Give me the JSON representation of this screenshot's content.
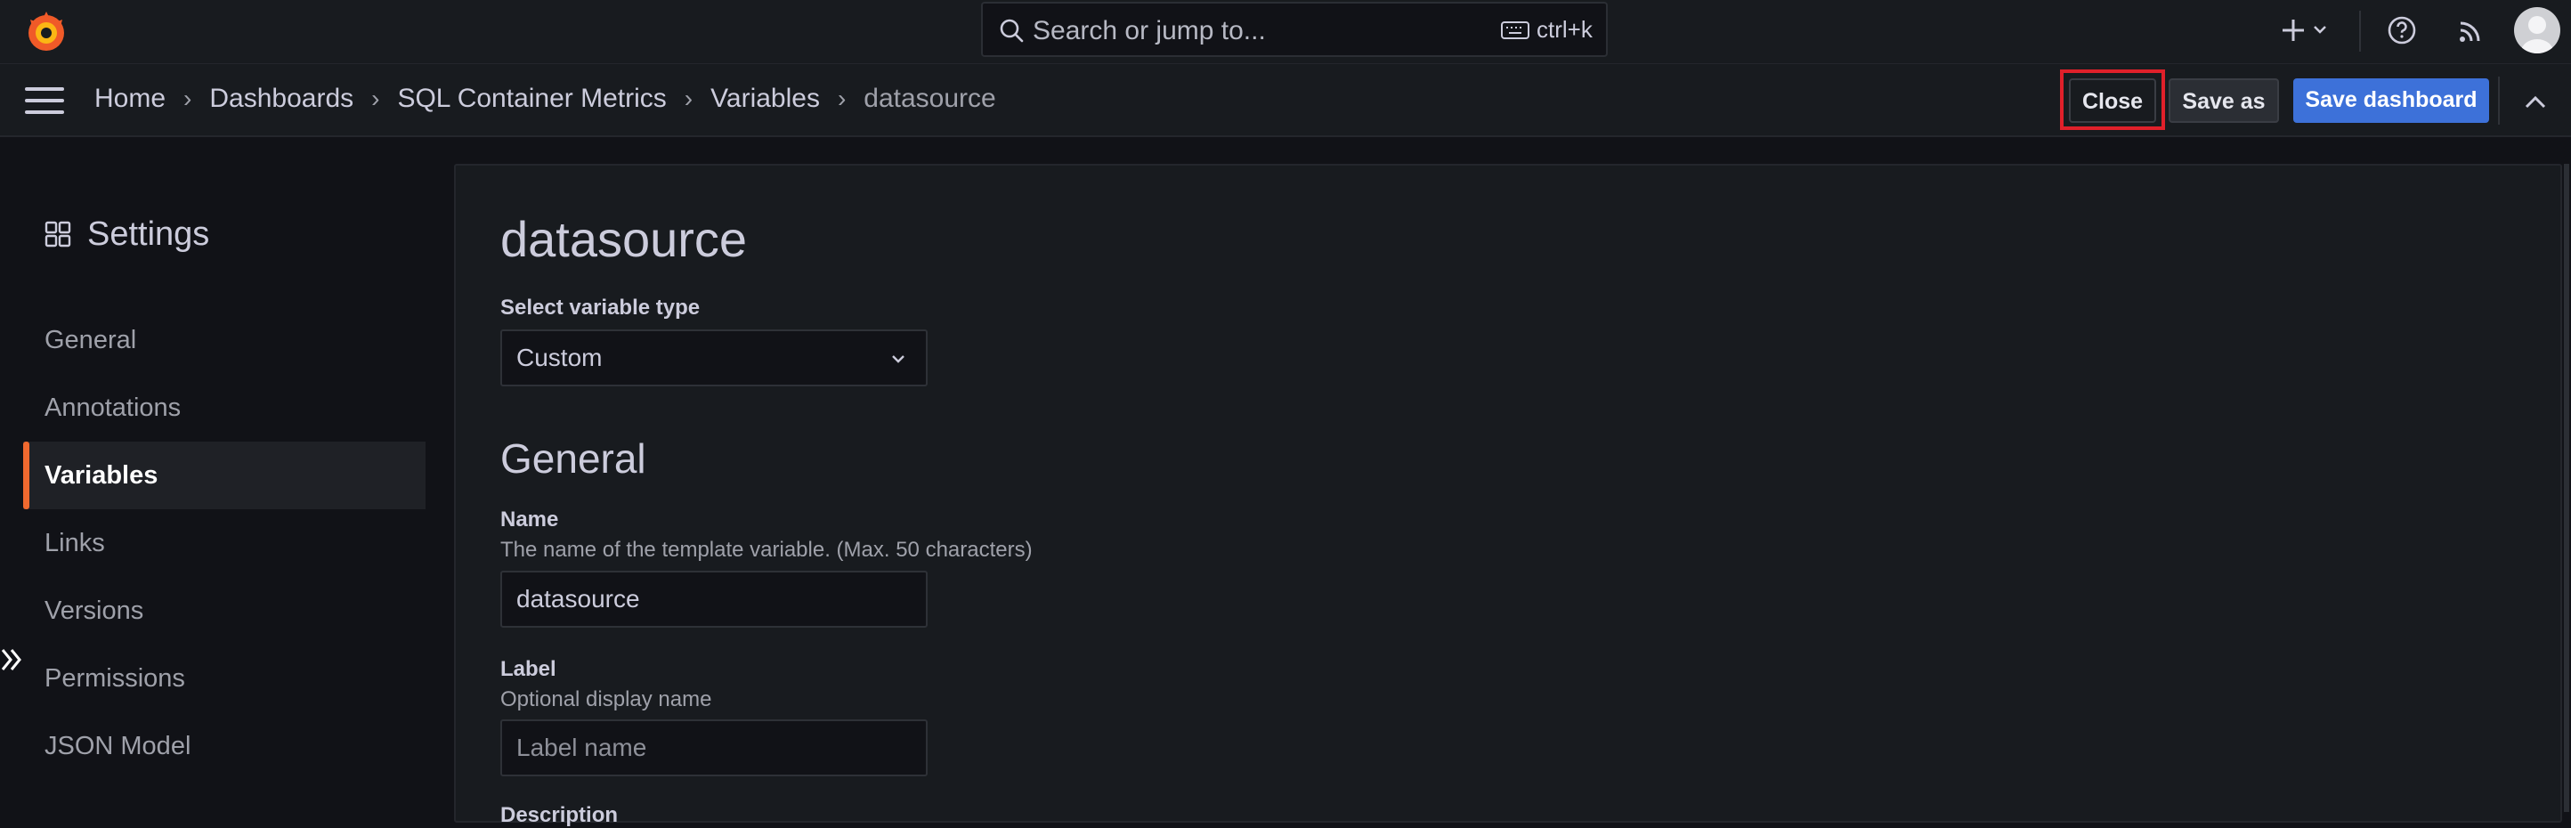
{
  "topbar": {
    "search_placeholder": "Search or jump to...",
    "shortcut": "ctrl+k"
  },
  "breadcrumbs": [
    "Home",
    "Dashboards",
    "SQL Container Metrics",
    "Variables",
    "datasource"
  ],
  "actions": {
    "close": "Close",
    "save_as": "Save as",
    "save_dashboard": "Save dashboard"
  },
  "sidebar": {
    "title": "Settings",
    "items": [
      {
        "label": "General",
        "active": false
      },
      {
        "label": "Annotations",
        "active": false
      },
      {
        "label": "Variables",
        "active": true
      },
      {
        "label": "Links",
        "active": false
      },
      {
        "label": "Versions",
        "active": false
      },
      {
        "label": "Permissions",
        "active": false
      },
      {
        "label": "JSON Model",
        "active": false
      }
    ]
  },
  "editor": {
    "heading": "datasource",
    "type_label": "Select variable type",
    "type_value": "Custom",
    "general_heading": "General",
    "name_label": "Name",
    "name_desc": "The name of the template variable. (Max. 50 characters)",
    "name_value": "datasource",
    "label_label": "Label",
    "label_desc": "Optional display name",
    "label_placeholder": "Label name",
    "next_label_partial": "Description"
  },
  "colors": {
    "accent_orange": "#f0692f",
    "primary_blue": "#3d71d9",
    "highlight_red": "#e0202a"
  }
}
